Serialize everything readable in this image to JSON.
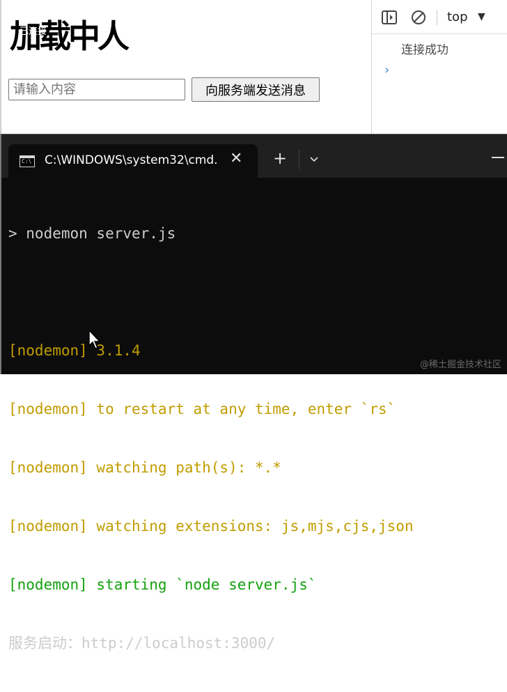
{
  "page": {
    "heading": "加载中人",
    "heading_overlay": "已连接",
    "input_placeholder": "请输入内容",
    "send_button": "向服务端发送消息"
  },
  "devtools": {
    "context": "top",
    "log_message": "连接成功",
    "prompt_glyph": "›"
  },
  "terminal": {
    "tab_title": "C:\\WINDOWS\\system32\\cmd.",
    "cmd_icon_text": "C:\\",
    "close_glyph": "✕",
    "new_tab_glyph": "+",
    "lines": [
      {
        "text": "> nodemon server.js",
        "color": "white"
      },
      {
        "text": "",
        "color": "white"
      },
      {
        "text": "[nodemon] 3.1.4",
        "color": "yellow"
      },
      {
        "text": "[nodemon] to restart at any time, enter `rs`",
        "color": "yellow"
      },
      {
        "text": "[nodemon] watching path(s): *.*",
        "color": "yellow"
      },
      {
        "text": "[nodemon] watching extensions: js,mjs,cjs,json",
        "color": "yellow"
      },
      {
        "text": "[nodemon] starting `node server.js`",
        "color": "green"
      }
    ],
    "last_line_label": "服务启动：",
    "last_line_url": "http://localhost:3000/"
  },
  "watermark": "@稀土掘金技术社区",
  "colors": {
    "yellow": "#c19c00",
    "green": "#13a10e",
    "white": "#cccccc",
    "terminal_bg": "#0c0c0c",
    "console_prompt": "#3a8ed4"
  }
}
